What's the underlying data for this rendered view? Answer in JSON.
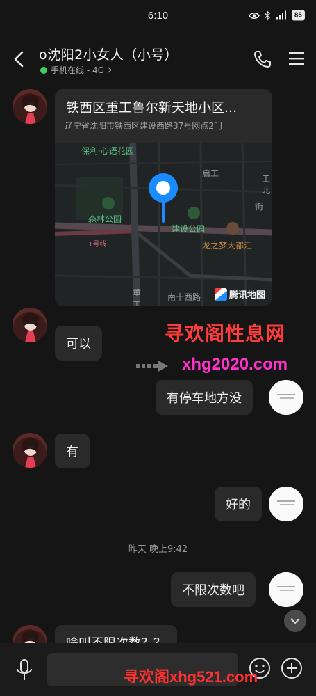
{
  "status_bar": {
    "time": "6:10",
    "battery": "85"
  },
  "header": {
    "title": "o沈阳2小女人（小号）",
    "presence": "手机在线 - 4G"
  },
  "messages": {
    "location": {
      "title": "铁西区重工鲁尔新天地小区...",
      "address": "辽宁省沈阳市铁西区建设西路37号网点2门",
      "map_labels": {
        "baoli": "保利·心语花园",
        "qigong": "启工",
        "gongbei": "工北",
        "jie": "街",
        "senlin": "森林公园",
        "jianshe": "建设公园",
        "longzhimeng": "龙之梦大都汇",
        "line1": "1号线",
        "zhonggong": "重工",
        "nanshixi": "南十西路"
      },
      "provider": "腾讯地图"
    },
    "m1": "可以",
    "m2": "有停车地方没",
    "m3": "有",
    "m4": "好的",
    "timestamp": "昨天 晚上9:42",
    "m5": "不限次数吧",
    "m6": "啥叫不限次数？？"
  },
  "watermarks": {
    "site_name": "寻欢阁性息网",
    "site_url": "xhg2020.com",
    "bottom": "寻欢阁xhg521.com"
  }
}
